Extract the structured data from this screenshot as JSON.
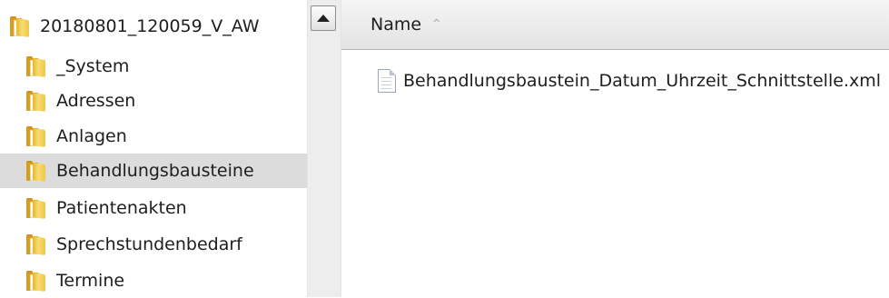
{
  "tree": {
    "root": {
      "label": "20180801_120059_V_AW",
      "icon": "folder-icon"
    },
    "children": [
      {
        "label": "_System",
        "icon": "folder-icon",
        "selected": false
      },
      {
        "label": "Adressen",
        "icon": "folder-icon",
        "selected": false
      },
      {
        "label": "Anlagen",
        "icon": "folder-icon",
        "selected": false
      },
      {
        "label": "Behandlungsbausteine",
        "icon": "folder-icon",
        "selected": true
      },
      {
        "label": "Patientenakten",
        "icon": "folder-icon",
        "selected": false
      },
      {
        "label": "Sprechstundenbedarf",
        "icon": "folder-icon",
        "selected": false
      },
      {
        "label": "Termine",
        "icon": "folder-icon",
        "selected": false
      }
    ]
  },
  "scrollbar": {
    "up_icon": "scroll-up-arrow-icon"
  },
  "content": {
    "column_header": {
      "name_label": "Name",
      "sort_icon": "sort-ascending-icon",
      "sort_glyph": "^"
    },
    "files": [
      {
        "name": "Behandlungsbaustein_Datum_Uhrzeit_Schnittstelle.xml",
        "icon": "xml-file-icon"
      }
    ]
  },
  "colors": {
    "selection": "#dcdcdc",
    "folder": "#efc64a",
    "header_bg": "#e8e8e8"
  }
}
